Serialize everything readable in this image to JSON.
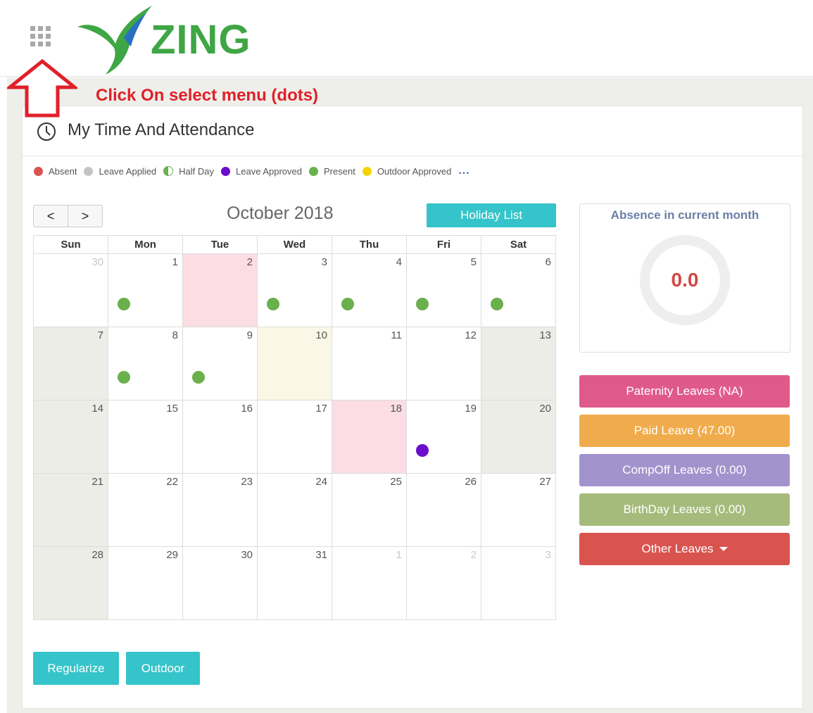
{
  "header": {
    "menu_icon": "grid-dots-icon",
    "logo_text": "ZING",
    "brand_color": "#3ea644"
  },
  "annotation": {
    "text": "Click On select menu (dots)",
    "color": "#e0202a"
  },
  "page": {
    "title": "My Time And Attendance",
    "title_icon": "clock-icon"
  },
  "legend": {
    "items": [
      {
        "label": "Absent",
        "color": "#d9534f"
      },
      {
        "label": "Leave Applied",
        "color": "#c4c4c4"
      },
      {
        "label": "Half Day",
        "color": "#6ab04c"
      },
      {
        "label": "Leave Approved",
        "color": "#6a0dcc"
      },
      {
        "label": "Present",
        "color": "#6ab04c"
      },
      {
        "label": "Outdoor Approved",
        "color": "#f5d300"
      }
    ],
    "more": "..."
  },
  "calendar": {
    "month_title": "October 2018",
    "prev": "<",
    "next": ">",
    "holiday_button": "Holiday List",
    "weekdays": [
      "Sun",
      "Mon",
      "Tue",
      "Wed",
      "Thu",
      "Fri",
      "Sat"
    ],
    "weeks": [
      [
        {
          "d": "30",
          "other": true
        },
        {
          "d": "1",
          "dot": "present"
        },
        {
          "d": "2",
          "bg": "pink"
        },
        {
          "d": "3",
          "dot": "present"
        },
        {
          "d": "4",
          "dot": "present"
        },
        {
          "d": "5",
          "dot": "present"
        },
        {
          "d": "6",
          "dot": "present"
        }
      ],
      [
        {
          "d": "7",
          "bg": "weekend"
        },
        {
          "d": "8",
          "dot": "present"
        },
        {
          "d": "9",
          "dot": "present"
        },
        {
          "d": "10",
          "bg": "cream"
        },
        {
          "d": "11"
        },
        {
          "d": "12"
        },
        {
          "d": "13",
          "bg": "weekend"
        }
      ],
      [
        {
          "d": "14",
          "bg": "weekend"
        },
        {
          "d": "15"
        },
        {
          "d": "16"
        },
        {
          "d": "17"
        },
        {
          "d": "18",
          "bg": "pink"
        },
        {
          "d": "19",
          "dot": "approved"
        },
        {
          "d": "20",
          "bg": "weekend"
        }
      ],
      [
        {
          "d": "21",
          "bg": "weekend"
        },
        {
          "d": "22"
        },
        {
          "d": "23"
        },
        {
          "d": "24"
        },
        {
          "d": "25"
        },
        {
          "d": "26"
        },
        {
          "d": "27"
        }
      ],
      [
        {
          "d": "28",
          "bg": "weekend"
        },
        {
          "d": "29"
        },
        {
          "d": "30"
        },
        {
          "d": "31"
        },
        {
          "d": "1",
          "other": true
        },
        {
          "d": "2",
          "other": true
        },
        {
          "d": "3",
          "other": true
        }
      ]
    ],
    "dot_colors": {
      "present": "#6ab04c",
      "approved": "#6a0dcc"
    }
  },
  "absence": {
    "title": "Absence in current month",
    "value": "0.0"
  },
  "leaves": [
    {
      "label": "Paternity Leaves (NA)",
      "color": "#df5a8b"
    },
    {
      "label": "Paid Leave (47.00)",
      "color": "#f0ac4c"
    },
    {
      "label": "CompOff Leaves (0.00)",
      "color": "#a393cd"
    },
    {
      "label": "BirthDay Leaves (0.00)",
      "color": "#a5bb7c"
    },
    {
      "label": "Other Leaves",
      "color": "#d9534f",
      "dropdown": true
    }
  ],
  "actions": {
    "regularize": "Regularize",
    "outdoor": "Outdoor"
  }
}
